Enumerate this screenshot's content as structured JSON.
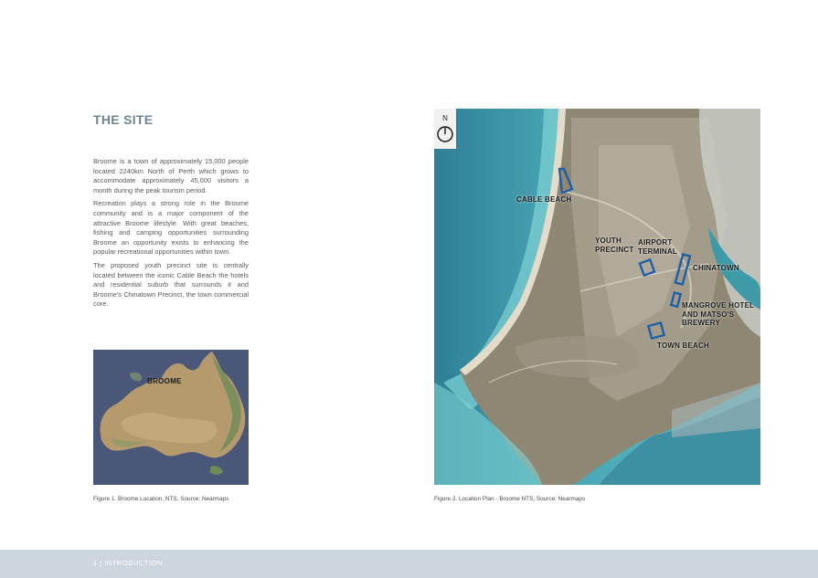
{
  "heading": "THE SITE",
  "paragraphs": [
    "Broome is a town of approximately 15,000 people located 2240km North of Perth which grows to accommodate approximately 45,000 visitors a month during the peak tourism period.",
    "Recreation plays a strong role in the Broome community and is a major component of the attractive Broome lifestyle.  With great beaches, fishing and camping opportunities surrounding Broome an opportunity exists to enhancing the popular recreational opportunities within town.",
    "The proposed youth precinct site is centrally located between the iconic Cable Beach the hotels and residential suburb that surrounds it and Broome's Chinatown Precinct, the town commercial core."
  ],
  "figure1": {
    "label": "BROOME",
    "caption": "Figure 1. Broome Location, NTS, Source: Nearmaps"
  },
  "figure2": {
    "north": "N",
    "labels": {
      "cable_beach": "CABLE BEACH",
      "youth_precinct_1": "YOUTH",
      "youth_precinct_2": "PRECINCT",
      "airport_terminal_1": "AIRPORT",
      "airport_terminal_2": "TERMINAL",
      "chinatown": "CHINATOWN",
      "mangrove_1": "MANGROVE HOTEL",
      "mangrove_2": "AND  MATSO'S",
      "mangrove_3": "BREWERY",
      "town_beach": "TOWN BEACH"
    },
    "caption": "Figure 2. Location Plan - Broome  NTS, Source: Nearmaps"
  },
  "footer": "1  |  INTRODUCTION",
  "colors": {
    "heading": "#6f8592",
    "footer_band": "#cdd5df",
    "marker": "#1f5fa8"
  }
}
